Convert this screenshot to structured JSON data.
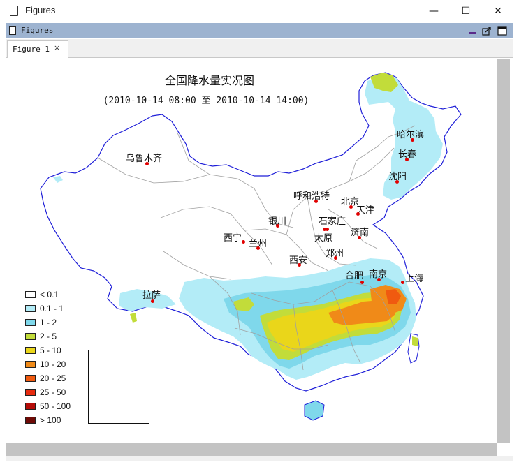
{
  "window": {
    "title": "Figures",
    "minimize_glyph": "—",
    "maximize_glyph": "☐",
    "close_glyph": "✕"
  },
  "frame": {
    "title": "Figures",
    "icons": [
      "minimize-icon",
      "undock-icon",
      "maximize-icon"
    ]
  },
  "tab": {
    "label": "Figure 1",
    "close_glyph": "×"
  },
  "map": {
    "title": "全国降水量实况图",
    "subtitle": "(2010-10-14 08:00 至 2010-10-14 14:00)",
    "legend": [
      {
        "label": "< 0.1",
        "color": "#ffffff"
      },
      {
        "label": "0.1 - 1",
        "color": "#b3ecf7"
      },
      {
        "label": "1 - 2",
        "color": "#7fd8eb"
      },
      {
        "label": "2 - 5",
        "color": "#c2dc3a"
      },
      {
        "label": "5 - 10",
        "color": "#ead61a"
      },
      {
        "label": "10 - 20",
        "color": "#f08a18"
      },
      {
        "label": "20 - 25",
        "color": "#f05a10"
      },
      {
        "label": "25 - 50",
        "color": "#e62a0e"
      },
      {
        "label": "50 - 100",
        "color": "#b40c08"
      },
      {
        "label": "> 100",
        "color": "#6e0a06"
      }
    ],
    "cities": [
      "哈尔滨",
      "长春",
      "沈阳",
      "乌鲁木齐",
      "呼和浩特",
      "北京",
      "天津",
      "石家庄",
      "太原",
      "济南",
      "银川",
      "西宁",
      "兰州",
      "郑州",
      "西安",
      "合肥",
      "南京",
      "上海",
      "拉萨"
    ]
  }
}
